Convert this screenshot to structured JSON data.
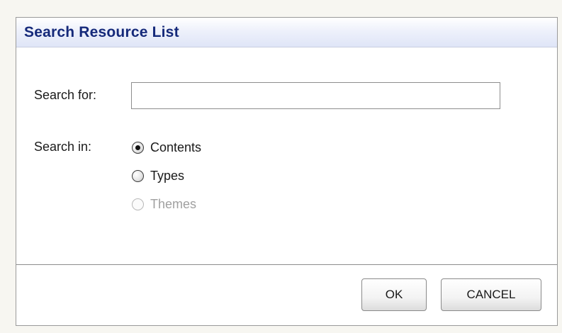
{
  "dialog": {
    "title": "Search Resource List"
  },
  "form": {
    "search_for_label": "Search for:",
    "search_value": "",
    "search_in_label": "Search in:",
    "options": [
      {
        "label": "Contents",
        "checked": true,
        "disabled": false
      },
      {
        "label": "Types",
        "checked": false,
        "disabled": false
      },
      {
        "label": "Themes",
        "checked": false,
        "disabled": true
      }
    ]
  },
  "buttons": {
    "ok_label": "OK",
    "cancel_label": "CANCEL"
  },
  "colors": {
    "title_text": "#15297a",
    "disabled_text": "#a0a0a0"
  }
}
